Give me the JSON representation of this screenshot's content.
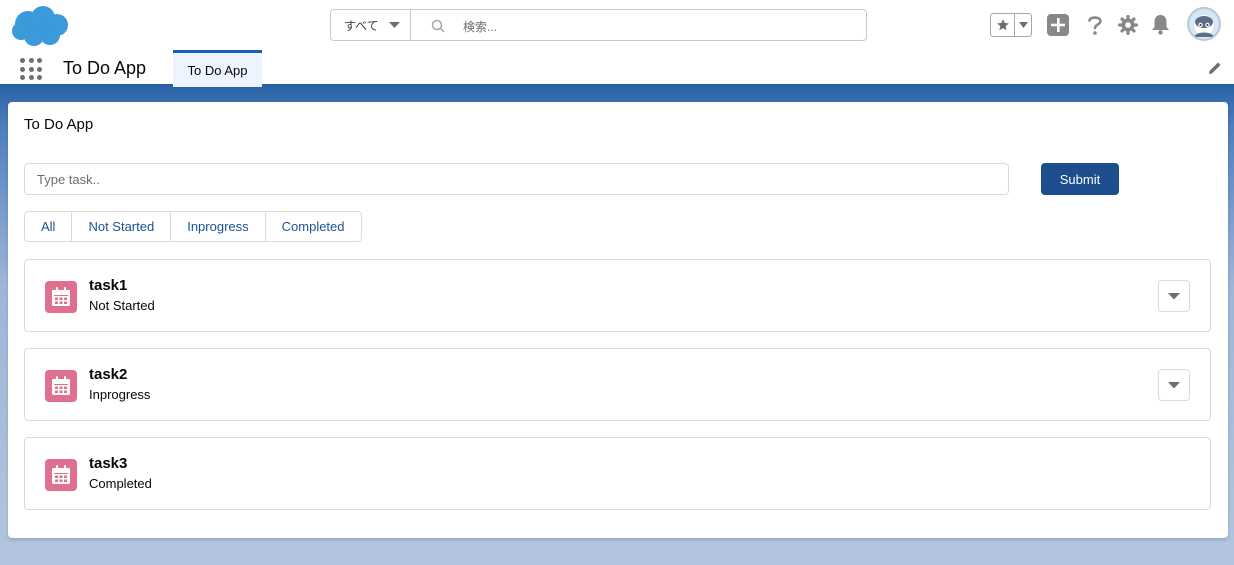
{
  "header": {
    "search_scope": "すべて",
    "search_placeholder": "検索...",
    "icons": [
      "salesforce-logo",
      "favorites-star-icon",
      "chevron-down-icon",
      "add-icon",
      "help-icon",
      "setup-gear-icon",
      "notification-bell-icon",
      "avatar"
    ]
  },
  "nav": {
    "app_name": "To Do App",
    "tabs": [
      {
        "label": "To Do App",
        "active": true
      }
    ],
    "icons": [
      "app-launcher-icon",
      "edit-pencil-icon"
    ]
  },
  "main": {
    "title": "To Do App",
    "input_placeholder": "Type task..",
    "submit_label": "Submit",
    "filters": [
      "All",
      "Not Started",
      "Inprogress",
      "Completed"
    ],
    "tasks": [
      {
        "name": "task1",
        "status": "Not Started",
        "has_menu": true
      },
      {
        "name": "task2",
        "status": "Inprogress",
        "has_menu": true
      },
      {
        "name": "task3",
        "status": "Completed",
        "has_menu": false
      }
    ]
  },
  "colors": {
    "brand_blue": "#1c4e8e",
    "link_blue": "#1b5297",
    "task_icon_pink": "#e0708f",
    "band_top": "#2b62a7",
    "logo_blue": "#3b9ad9"
  }
}
